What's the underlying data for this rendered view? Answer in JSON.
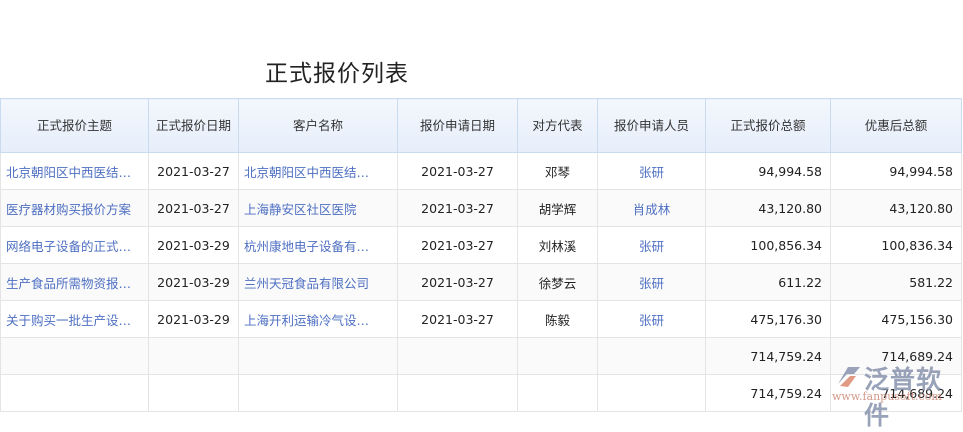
{
  "title": "正式报价列表",
  "columns": [
    "正式报价主题",
    "正式报价日期",
    "客户名称",
    "报价申请日期",
    "对方代表",
    "报价申请人员",
    "正式报价总额",
    "优惠后总额"
  ],
  "rows": [
    {
      "subject": "北京朝阳区中西医结…",
      "date": "2021-03-27",
      "customer": "北京朝阳区中西医结…",
      "apply_date": "2021-03-27",
      "rep": "邓琴",
      "applicant": "张研",
      "total": "94,994.58",
      "discounted": "94,994.58"
    },
    {
      "subject": "医疗器材购买报价方案",
      "date": "2021-03-27",
      "customer": "上海静安区社区医院",
      "apply_date": "2021-03-27",
      "rep": "胡学辉",
      "applicant": "肖成林",
      "total": "43,120.80",
      "discounted": "43,120.80"
    },
    {
      "subject": "网络电子设备的正式…",
      "date": "2021-03-29",
      "customer": "杭州康地电子设备有…",
      "apply_date": "2021-03-27",
      "rep": "刘林溪",
      "applicant": "张研",
      "total": "100,856.34",
      "discounted": "100,836.34"
    },
    {
      "subject": "生产食品所需物资报…",
      "date": "2021-03-29",
      "customer": "兰州天冠食品有限公司",
      "apply_date": "2021-03-27",
      "rep": "徐梦云",
      "applicant": "张研",
      "total": "611.22",
      "discounted": "581.22"
    },
    {
      "subject": "关于购买一批生产设…",
      "date": "2021-03-29",
      "customer": "上海开利运输冷气设…",
      "apply_date": "2021-03-27",
      "rep": "陈毅",
      "applicant": "张研",
      "total": "475,176.30",
      "discounted": "475,156.30"
    }
  ],
  "summary_rows": [
    {
      "total": "714,759.24",
      "discounted": "714,689.24"
    },
    {
      "total": "714,759.24",
      "discounted": "714,689.24"
    }
  ],
  "watermark": {
    "brand": "泛普软件",
    "url": "www.fanpusoft.com"
  },
  "colors": {
    "link": "#4e6fc2",
    "header_bg": "#e6eefa"
  }
}
